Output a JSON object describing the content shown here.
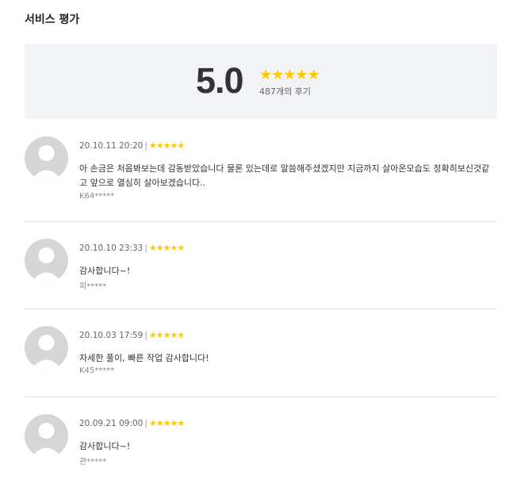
{
  "title": "서비스 평가",
  "summary": {
    "score": "5.0",
    "stars": "★★★★★",
    "review_count": "487개의 후기"
  },
  "reviews": [
    {
      "date": "20.10.11 20:20",
      "stars": "★★★★★",
      "content": "아 손금은 처음봐보는데 감동받았습니다 물론 있는데로 말씀해주셨겠지만 지금까지 살아온모습도 정확히보신것같고 앞으로 열심히 살아보겠습니다..",
      "author": "K64*****"
    },
    {
      "date": "20.10.10 23:33",
      "stars": "★★★★★",
      "content": "감사합니다~!",
      "author": "피*****"
    },
    {
      "date": "20.10.03 17:59",
      "stars": "★★★★★",
      "content": "자세한 풀이, 빠른 작업 감사합니다!",
      "author": "K45*****"
    },
    {
      "date": "20.09.21 09:00",
      "stars": "★★★★★",
      "content": "감사합니다~!",
      "author": "관*****"
    }
  ],
  "colors": {
    "star": "#ffc800",
    "summary_bg": "#f2f3f7",
    "avatar_bg": "#d6d6d6"
  },
  "rating_value": 5
}
